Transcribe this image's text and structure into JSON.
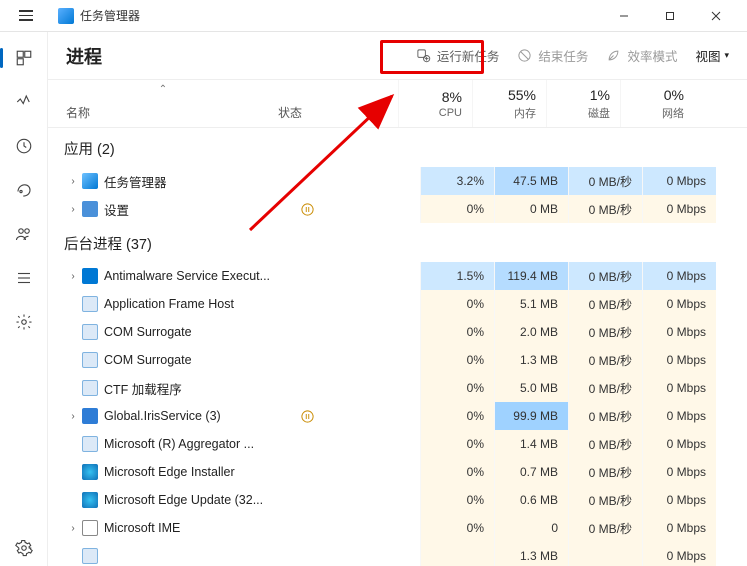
{
  "window": {
    "title": "任务管理器"
  },
  "page": {
    "title": "进程"
  },
  "toolbar": {
    "run_new_task": "运行新任务",
    "end_task": "结束任务",
    "efficiency_mode": "效率模式",
    "view": "视图"
  },
  "columns": {
    "name": "名称",
    "status": "状态",
    "metrics": [
      {
        "pct": "8%",
        "label": "CPU"
      },
      {
        "pct": "55%",
        "label": "内存"
      },
      {
        "pct": "1%",
        "label": "磁盘"
      },
      {
        "pct": "0%",
        "label": "网络"
      }
    ]
  },
  "groups": [
    {
      "title": "应用 (2)"
    },
    {
      "title": "后台进程 (37)"
    }
  ],
  "rows": [
    {
      "group": 0,
      "icon": "tm",
      "expand": true,
      "paused": false,
      "name": "任务管理器",
      "cpu": "3.2%",
      "mem": "47.5 MB",
      "disk": "0 MB/秒",
      "net": "0 Mbps",
      "sel": true,
      "memHeat": 1
    },
    {
      "group": 0,
      "icon": "gear",
      "expand": true,
      "paused": true,
      "name": "设置",
      "cpu": "0%",
      "mem": "0 MB",
      "disk": "0 MB/秒",
      "net": "0 Mbps",
      "sel": false,
      "memHeat": 0
    },
    {
      "group": 1,
      "icon": "shield",
      "expand": true,
      "paused": false,
      "name": "Antimalware Service Execut...",
      "cpu": "1.5%",
      "mem": "119.4 MB",
      "disk": "0 MB/秒",
      "net": "0 Mbps",
      "sel": true,
      "memHeat": 2
    },
    {
      "group": 1,
      "icon": "app",
      "expand": false,
      "paused": false,
      "name": "Application Frame Host",
      "cpu": "0%",
      "mem": "5.1 MB",
      "disk": "0 MB/秒",
      "net": "0 Mbps",
      "sel": false,
      "memHeat": 0
    },
    {
      "group": 1,
      "icon": "app",
      "expand": false,
      "paused": false,
      "name": "COM Surrogate",
      "cpu": "0%",
      "mem": "2.0 MB",
      "disk": "0 MB/秒",
      "net": "0 Mbps",
      "sel": false,
      "memHeat": 0
    },
    {
      "group": 1,
      "icon": "app",
      "expand": false,
      "paused": false,
      "name": "COM Surrogate",
      "cpu": "0%",
      "mem": "1.3 MB",
      "disk": "0 MB/秒",
      "net": "0 Mbps",
      "sel": false,
      "memHeat": 0
    },
    {
      "group": 1,
      "icon": "app",
      "expand": false,
      "paused": false,
      "name": "CTF 加载程序",
      "cpu": "0%",
      "mem": "5.0 MB",
      "disk": "0 MB/秒",
      "net": "0 Mbps",
      "sel": false,
      "memHeat": 0
    },
    {
      "group": 1,
      "icon": "iris",
      "expand": true,
      "paused": true,
      "name": "Global.IrisService (3)",
      "cpu": "0%",
      "mem": "99.9 MB",
      "disk": "0 MB/秒",
      "net": "0 Mbps",
      "sel": false,
      "memHeat": 2,
      "memSel": true
    },
    {
      "group": 1,
      "icon": "app",
      "expand": false,
      "paused": false,
      "name": "Microsoft (R) Aggregator ...",
      "cpu": "0%",
      "mem": "1.4 MB",
      "disk": "0 MB/秒",
      "net": "0 Mbps",
      "sel": false,
      "memHeat": 0
    },
    {
      "group": 1,
      "icon": "edge",
      "expand": false,
      "paused": false,
      "name": "Microsoft Edge Installer",
      "cpu": "0%",
      "mem": "0.7 MB",
      "disk": "0 MB/秒",
      "net": "0 Mbps",
      "sel": false,
      "memHeat": 0
    },
    {
      "group": 1,
      "icon": "edge",
      "expand": false,
      "paused": false,
      "name": "Microsoft Edge Update (32...",
      "cpu": "0%",
      "mem": "0.6 MB",
      "disk": "0 MB/秒",
      "net": "0 Mbps",
      "sel": false,
      "memHeat": 0
    },
    {
      "group": 1,
      "icon": "ime",
      "expand": true,
      "paused": false,
      "name": "Microsoft IME",
      "cpu": "0%",
      "mem": "0",
      "disk": "0 MB/秒",
      "net": "0 Mbps",
      "sel": false,
      "memHeat": 0,
      "split": true
    },
    {
      "group": 1,
      "icon": "app",
      "expand": false,
      "paused": false,
      "name": "",
      "cpu": "",
      "mem": "1.3 MB",
      "disk": "",
      "net": "0 Mbps",
      "sel": false,
      "memHeat": 0
    }
  ],
  "icons": {
    "tm": {
      "bg": "linear-gradient(135deg,#6ec1ff,#0078d4)"
    },
    "gear": {
      "bg": "#4a90d9"
    },
    "shield": {
      "bg": "#0078d4"
    },
    "app": {
      "bg": "#dce9f7",
      "border": "1px solid #7fb3e0"
    },
    "iris": {
      "bg": "#2e7cd6"
    },
    "edge": {
      "bg": "radial-gradient(circle,#35c1f1,#0f70b7)"
    },
    "ime": {
      "bg": "#fff",
      "border": "1px solid #888"
    }
  }
}
